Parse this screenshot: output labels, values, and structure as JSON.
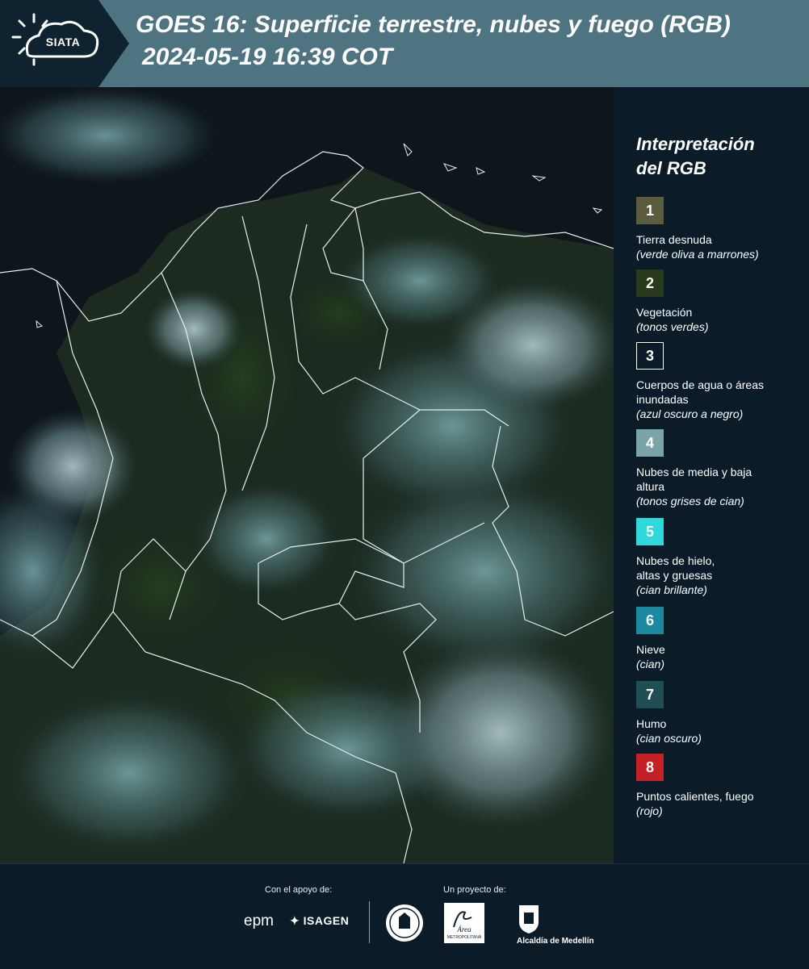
{
  "header": {
    "logo_text": "SIATA",
    "title_line1": "GOES 16: Superficie terrestre, nubes y fuego (RGB)",
    "title_line2": "2024-05-19 16:39 COT"
  },
  "map": {
    "description_icon": "satellite-rgb-composite"
  },
  "legend": {
    "title_line1": "Interpretación",
    "title_line2": "del RGB",
    "items": [
      {
        "number": "1",
        "label": "Tierra desnuda",
        "sub": "(verde oliva a marrones)",
        "color": "#5b5b3e"
      },
      {
        "number": "2",
        "label": "Vegetación",
        "sub": "(tonos verdes)",
        "color": "#2a3a1c"
      },
      {
        "number": "3",
        "label": "Cuerpos de agua o áreas inundadas",
        "sub": "(azul oscuro a negro)",
        "color": "#0b1c28"
      },
      {
        "number": "4",
        "label": "Nubes de media y baja altura",
        "sub": "(tonos grises de cian)",
        "color": "#7ba4a6"
      },
      {
        "number": "5",
        "label": "Nubes de hielo, altas y gruesas",
        "sub": "(cian brillante)",
        "color": "#2fd9db"
      },
      {
        "number": "6",
        "label": "Nieve",
        "sub": "(cian)",
        "color": "#1b8aa0"
      },
      {
        "number": "7",
        "label": "Humo",
        "sub": "(cian oscuro)",
        "color": "#1f4e55"
      },
      {
        "number": "8",
        "label": "Puntos calientes, fuego",
        "sub": "(rojo)",
        "color": "#c42025"
      }
    ]
  },
  "footer": {
    "support_label": "Con el apoyo de:",
    "project_label": "Un proyecto de:",
    "epm": "epm",
    "isagen": "ISAGEN",
    "area_text": "Área",
    "area_sub": "METROPOLITANA",
    "medellin": "Alcaldía de Medellín"
  }
}
